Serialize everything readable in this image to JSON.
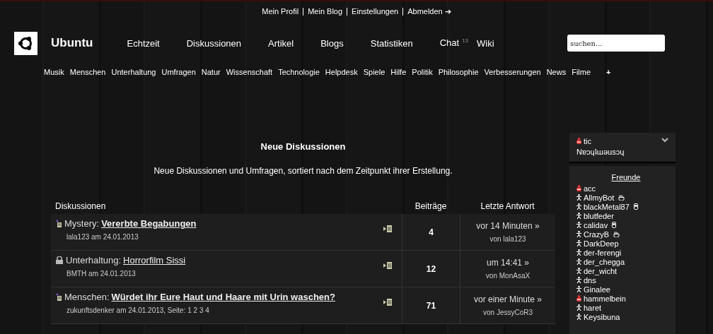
{
  "top_links": [
    "Mein Profil",
    "Mein Blog",
    "Einstellungen",
    "Abmelden ➔"
  ],
  "site_title": "Ubuntu",
  "nav": [
    {
      "label": "Echtzeit"
    },
    {
      "label": "Diskussionen"
    },
    {
      "label": "Artikel"
    },
    {
      "label": "Blogs"
    },
    {
      "label": "Statistiken"
    },
    {
      "label": "Chat",
      "count": "13"
    },
    {
      "label": "Wiki"
    }
  ],
  "search": {
    "placeholder": "suchen..."
  },
  "categories": [
    "Musik",
    "Menschen",
    "Unterhaltung",
    "Umfragen",
    "Natur",
    "Wissenschaft",
    "Technologie",
    "Helpdesk",
    "Spiele",
    "Hilfe",
    "Politik",
    "Philosophie",
    "Verbesserungen",
    "News",
    "Filme",
    "+"
  ],
  "heading": "Neue Diskussionen",
  "subheading": "Neue Diskussionen und Umfragen, sortiert nach dem Zeitpunkt ihrer Erstellung.",
  "table": {
    "columns": [
      "Diskussionen",
      "Beiträge",
      "Letzte Antwort"
    ],
    "rows": [
      {
        "kind": "new",
        "category": "Mystery:",
        "title": "Vererbte Begabungen",
        "bold": true,
        "meta": "lala123 am 24.01.2013",
        "count": "4",
        "last": "vor 14 Minuten »",
        "by": "von lala123"
      },
      {
        "kind": "locked",
        "category": "Unterhaltung:",
        "title": "Horrorfilm Sissi",
        "bold": false,
        "meta": "BMTH am 24.01.2013",
        "count": "12",
        "last": "um 14:41 »",
        "by": "von MonAsaX"
      },
      {
        "kind": "new",
        "category": "Menschen:",
        "title": "Würdet ihr Eure Haut und Haare mit Urin waschen?",
        "bold": true,
        "meta": "zukunftsdenker am 24.01.2013, Seite: 1 2 3 4",
        "count": "71",
        "last": "vor einer Minute »",
        "by": "von JessyCoR3"
      }
    ]
  },
  "user": {
    "name": "tic",
    "busy": true,
    "motto": "Nɐɔɥʇɯǝusɔɥ"
  },
  "friends": {
    "title": "Freunde",
    "items": [
      {
        "name": "acc",
        "busy": true,
        "mobile": false,
        "idle": false
      },
      {
        "name": "AllmyBot",
        "busy": false,
        "mobile": false,
        "idle": true
      },
      {
        "name": "blackMetal87",
        "busy": false,
        "mobile": true,
        "idle": false
      },
      {
        "name": "blutfeder",
        "busy": false,
        "mobile": false,
        "idle": false
      },
      {
        "name": "calidav",
        "busy": false,
        "mobile": true,
        "idle": false
      },
      {
        "name": "CrazyB",
        "busy": false,
        "mobile": false,
        "idle": true
      },
      {
        "name": "DarkDeep",
        "busy": false,
        "mobile": false,
        "idle": false
      },
      {
        "name": "der-ferengi",
        "busy": false,
        "mobile": false,
        "idle": false
      },
      {
        "name": "der_chegga",
        "busy": false,
        "mobile": false,
        "idle": false
      },
      {
        "name": "der_wicht",
        "busy": false,
        "mobile": false,
        "idle": false
      },
      {
        "name": "dns",
        "busy": false,
        "mobile": false,
        "idle": false
      },
      {
        "name": "Ginalee",
        "busy": false,
        "mobile": false,
        "idle": false
      },
      {
        "name": "hammelbein",
        "busy": true,
        "mobile": false,
        "idle": false
      },
      {
        "name": "haret",
        "busy": false,
        "mobile": false,
        "idle": false
      },
      {
        "name": "Keysibuna",
        "busy": false,
        "mobile": false,
        "idle": false
      }
    ]
  }
}
